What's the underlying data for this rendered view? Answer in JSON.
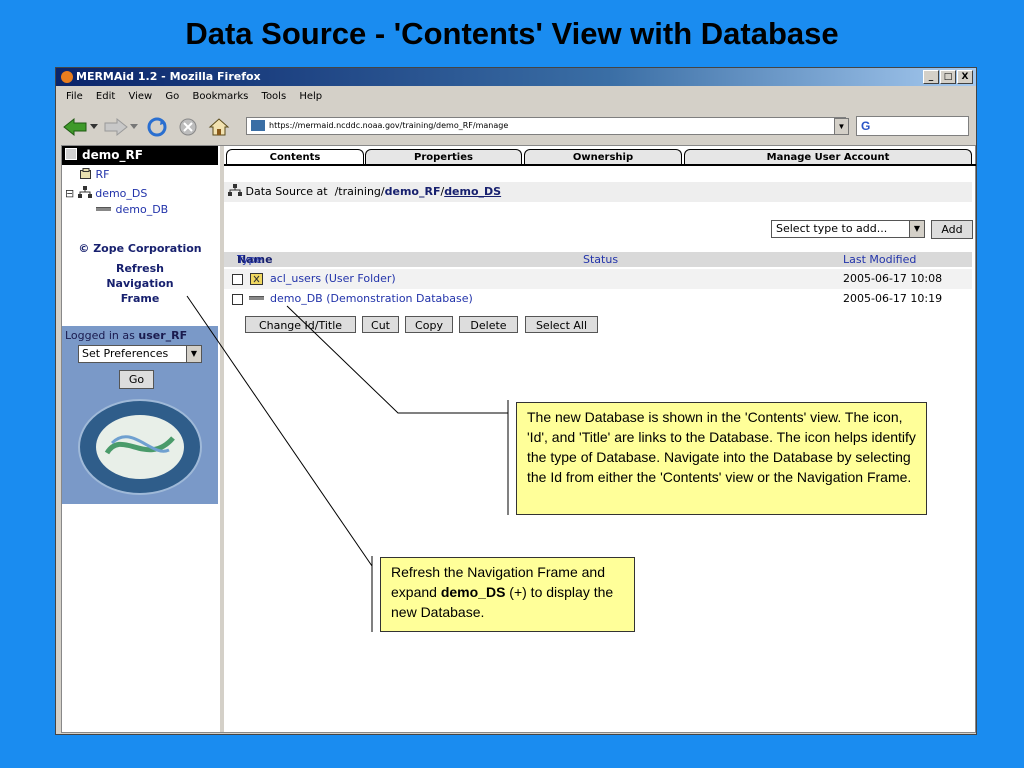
{
  "slide": {
    "title": "Data Source -  'Contents' View with Database"
  },
  "window": {
    "title": "MERMAid 1.2 - Mozilla Firefox",
    "controls": [
      "_",
      "□",
      "X"
    ]
  },
  "menu": [
    "File",
    "Edit",
    "View",
    "Go",
    "Bookmarks",
    "Tools",
    "Help"
  ],
  "url": "https://mermaid.ncddc.noaa.gov/training/demo_RF/manage",
  "search": {
    "engine": "G"
  },
  "nav": {
    "root": "demo_RF",
    "items": [
      {
        "label": "RF"
      },
      {
        "label": "demo_DS",
        "expander": "⊟"
      },
      {
        "label": "demo_DB"
      }
    ],
    "zope": "© Zope Corporation",
    "refresh": [
      "Refresh",
      "Navigation",
      "Frame"
    ],
    "logged_in_prefix": "Logged in as",
    "user": "user_RF",
    "preference_select": "Set Preferences",
    "go": "Go"
  },
  "tabs": [
    "Contents",
    "Properties",
    "Ownership",
    "Manage User Account"
  ],
  "header": {
    "prefix": "Data Source at",
    "path": "/training/",
    "link1": "demo_RF",
    "sep": "/",
    "link2": "demo_DS"
  },
  "add": {
    "select": "Select type to add...",
    "button": "Add"
  },
  "table": {
    "type_header": "Type",
    "name_header": "Name",
    "status_header": "Status",
    "modified_header": "Last Modified",
    "rows": [
      {
        "name": "acl_users (User Folder)",
        "modified": "2005-06-17 10:08"
      },
      {
        "name": "demo_DB (Demonstration Database)",
        "modified": "2005-06-17 10:19"
      }
    ]
  },
  "actions": [
    "Change Id/Title",
    "Cut",
    "Copy",
    "Delete",
    "Select All"
  ],
  "callouts": {
    "database": "The new Database is shown in the 'Contents' view. The icon, 'Id', and 'Title' are links to the Database. The icon helps identify the type of Database. Navigate into the Database by selecting the Id from either the 'Contents' view or the Navigation Frame.",
    "refresh_pre": "Refresh the Navigation Frame and expand ",
    "refresh_bold": "demo_DS",
    "refresh_post": " (+) to display the new Database."
  }
}
